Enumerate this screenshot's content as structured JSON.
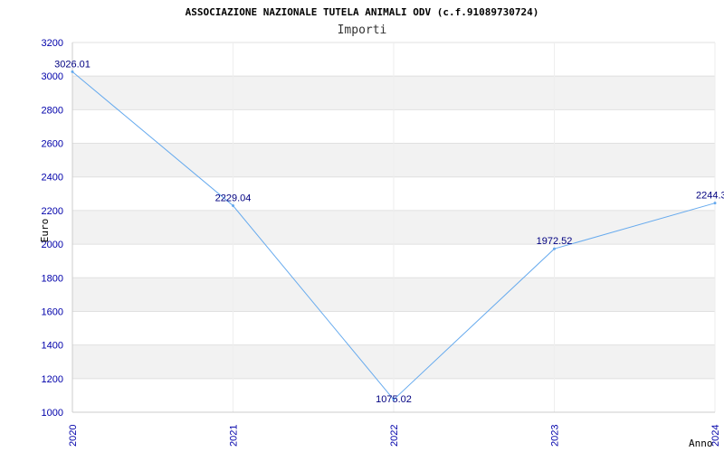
{
  "chart_data": {
    "type": "line",
    "title": "ASSOCIAZIONE NAZIONALE TUTELA ANIMALI ODV (c.f.91089730724)",
    "subtitle": "Importi",
    "xlabel": "Anno",
    "ylabel": "Euro",
    "x": [
      "2020",
      "2021",
      "2022",
      "2023",
      "2024"
    ],
    "values": [
      3026.01,
      2229.04,
      1075.02,
      1972.52,
      2244.3
    ],
    "data_labels": [
      "3026.01",
      "2229.04",
      "1075.02",
      "1972.52",
      "2244.3"
    ],
    "ylim": [
      1000,
      3200
    ],
    "yticks": [
      "1000",
      "1200",
      "1400",
      "1600",
      "1800",
      "2000",
      "2200",
      "2400",
      "2600",
      "2800",
      "3000",
      "3200"
    ],
    "grid": "horizontal alternating bands",
    "colors": {
      "line": "#66aaee",
      "band": "#f2f2f2",
      "tick_text": "#0000aa",
      "label_text": "#000080"
    }
  }
}
